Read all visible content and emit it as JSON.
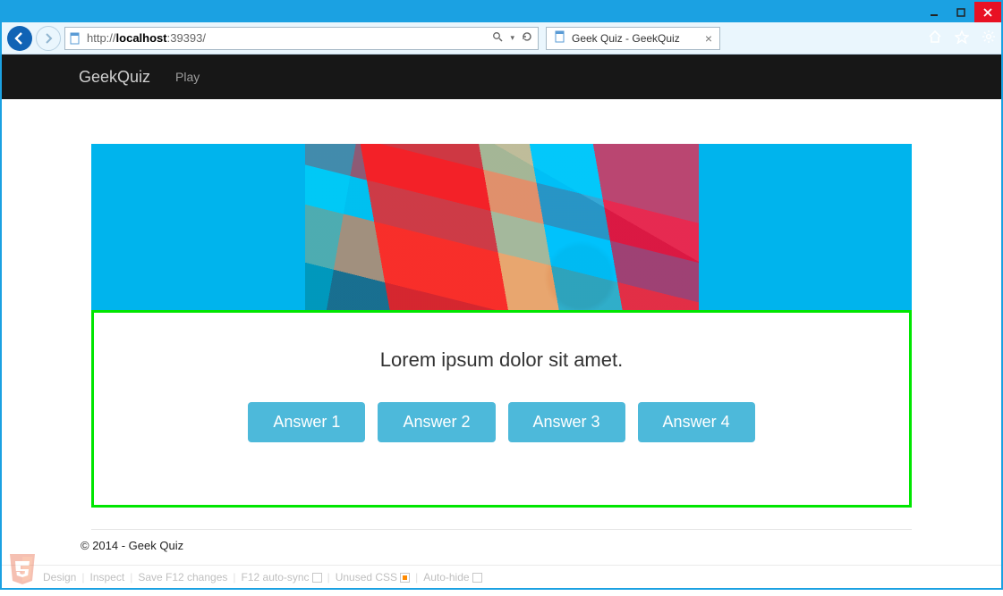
{
  "window": {
    "tab_title": "Geek Quiz - GeekQuiz",
    "url_prefix": "http://",
    "url_host": "localhost",
    "url_port": ":39393/",
    "icons": {
      "home": "home-icon",
      "star": "star-icon",
      "gear": "gear-icon"
    }
  },
  "nav": {
    "brand": "GeekQuiz",
    "items": [
      {
        "label": "Play"
      }
    ]
  },
  "quiz": {
    "question": "Lorem ipsum dolor sit amet.",
    "answers": [
      {
        "label": "Answer 1"
      },
      {
        "label": "Answer 2"
      },
      {
        "label": "Answer 3"
      },
      {
        "label": "Answer 4"
      }
    ]
  },
  "footer": {
    "text": "© 2014 - Geek Quiz"
  },
  "devbar": {
    "design": "Design",
    "inspect": "Inspect",
    "saveF12": "Save F12 changes",
    "autosync": "F12 auto-sync",
    "unusedCss": "Unused CSS",
    "autohide": "Auto-hide"
  }
}
